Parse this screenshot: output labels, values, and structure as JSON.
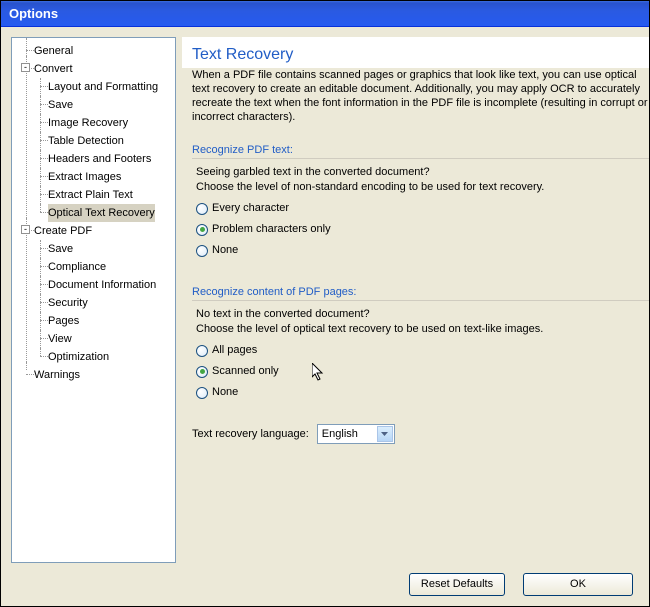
{
  "window": {
    "title": "Options"
  },
  "tree": {
    "general": "General",
    "convert": {
      "label": "Convert",
      "items": [
        "Layout and Formatting",
        "Save",
        "Image Recovery",
        "Table Detection",
        "Headers and Footers",
        "Extract Images",
        "Extract Plain Text",
        "Optical Text Recovery"
      ]
    },
    "createpdf": {
      "label": "Create PDF",
      "items": [
        "Save",
        "Compliance",
        "Document Information",
        "Security",
        "Pages",
        "View",
        "Optimization"
      ]
    },
    "warnings": "Warnings"
  },
  "page": {
    "title": "Text Recovery",
    "description": "When a PDF file contains scanned pages or graphics that look like text, you can use optical text recovery to create an editable document. Additionally, you may apply OCR to accurately recreate the text when the font information in the PDF file is incomplete (resulting in corrupt or incorrect characters)."
  },
  "group1": {
    "title": "Recognize PDF text:",
    "line1": "Seeing garbled text in the converted document?",
    "line2": "Choose the level of non-standard encoding to be used for text recovery.",
    "options": [
      "Every character",
      "Problem characters only",
      "None"
    ],
    "selected": "Problem characters only"
  },
  "group2": {
    "title": "Recognize content of PDF pages:",
    "line1": "No text in the converted document?",
    "line2": "Choose the level of optical text recovery to be used on text-like images.",
    "options": [
      "All pages",
      "Scanned only",
      "None"
    ],
    "selected": "Scanned only"
  },
  "lang": {
    "label": "Text recovery language:",
    "value": "English"
  },
  "buttons": {
    "reset": "Reset Defaults",
    "ok": "OK"
  }
}
